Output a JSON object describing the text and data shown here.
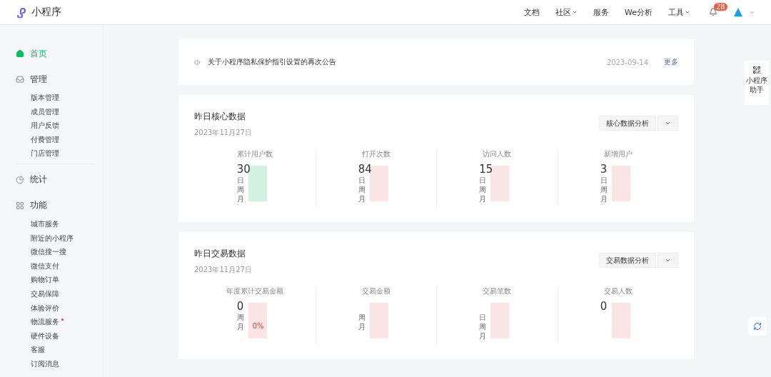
{
  "header": {
    "logo": "小程序",
    "nav": [
      {
        "label": "文档",
        "dropdown": false
      },
      {
        "label": "社区",
        "dropdown": true
      },
      {
        "label": "服务",
        "dropdown": false
      },
      {
        "label": "We分析",
        "dropdown": false
      },
      {
        "label": "工具",
        "dropdown": true
      }
    ],
    "notifications": "28"
  },
  "sidebar": {
    "groups": [
      {
        "label": "首页",
        "selected": true
      },
      {
        "label": "管理",
        "selected": false,
        "children": [
          {
            "label": "版本管理"
          },
          {
            "label": "成员管理"
          },
          {
            "label": "用户反馈"
          },
          {
            "label": "付费管理"
          },
          {
            "label": "门店管理"
          }
        ]
      },
      {
        "label": "统计",
        "selected": false
      },
      {
        "label": "功能",
        "selected": false,
        "children": [
          {
            "label": "城市服务",
            "dot": false
          },
          {
            "label": "附近的小程序",
            "dot": false
          },
          {
            "label": "微信搜一搜",
            "dot": false
          },
          {
            "label": "微信支付",
            "dot": false
          },
          {
            "label": "购物订单",
            "dot": false
          },
          {
            "label": "交易保障",
            "dot": false
          },
          {
            "label": "体验评价",
            "dot": false
          },
          {
            "label": "物流服务",
            "dot": true
          },
          {
            "label": "硬件设备",
            "dot": false
          },
          {
            "label": "客服",
            "dot": false
          },
          {
            "label": "订阅消息",
            "dot": false
          }
        ]
      }
    ]
  },
  "notice": {
    "text": "关于小程序隐私保护指引设置的再次公告",
    "date": "2023-09-14",
    "more": "更多"
  },
  "sections": [
    {
      "title": "昨日核心数据",
      "date": "2023年11月27日",
      "button": "核心数据分析",
      "stats": [
        {
          "label": "累计用户数",
          "value": "30",
          "rows": [
            "日",
            "周",
            "月"
          ],
          "color": "#d3f1e0"
        },
        {
          "label": "打开次数",
          "value": "84",
          "rows": [
            "日",
            "周",
            "月"
          ],
          "color": "#fbe4e4"
        },
        {
          "label": "访问人数",
          "value": "15",
          "rows": [
            "日",
            "周",
            "月"
          ],
          "color": "#fbe4e4"
        },
        {
          "label": "新增用户",
          "value": "3",
          "rows": [
            "日",
            "周",
            "月"
          ],
          "color": "#fbe4e4"
        }
      ]
    },
    {
      "title": "昨日交易数据",
      "date": "2023年11月27日",
      "button": "交易数据分析",
      "stats": [
        {
          "label": "年度累计交易金额",
          "value": "0",
          "rows": [
            "周",
            "月"
          ],
          "month": "0%",
          "color": "#fbe4e4"
        },
        {
          "label": "交易金额",
          "rows": [
            "周",
            "月"
          ],
          "color": "#fbe4e4"
        },
        {
          "label": "交易笔数",
          "rows": [
            "日",
            "周",
            "月"
          ],
          "color": "#fbe4e4"
        },
        {
          "label": "交易人数",
          "value": "0",
          "color": "#fbe4e4"
        }
      ]
    }
  ],
  "helper": {
    "label": "小程序助手"
  }
}
